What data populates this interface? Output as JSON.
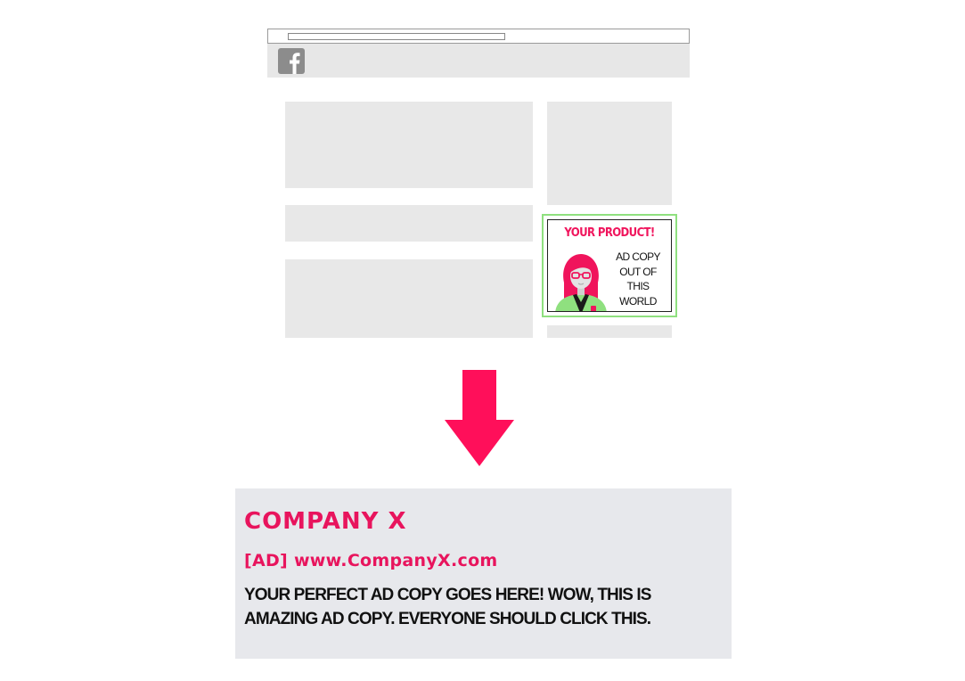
{
  "colors": {
    "accent": "#f0145c",
    "highlight_border": "#8fe07f",
    "placeholder_gray": "#e8e8e8",
    "ad_preview_bg": "#e7e8ec",
    "fb_icon": "#8c8c8c"
  },
  "browser": {
    "logo_icon": "facebook-icon"
  },
  "sidebar_ad": {
    "headline": "YOUR PRODUCT!",
    "copy_lines": [
      "AD COPY",
      "OUT OF",
      "THIS",
      "WORLD"
    ],
    "image_icon": "woman-avatar-icon"
  },
  "arrow_icon": "arrow-down-icon",
  "text_ad": {
    "company": "COMPANY X",
    "url_line": "[AD] www.CompanyX.com",
    "body": "YOUR PERFECT AD COPY GOES HERE! WOW, THIS IS AMAZING AD COPY. EVERYONE SHOULD CLICK THIS."
  }
}
